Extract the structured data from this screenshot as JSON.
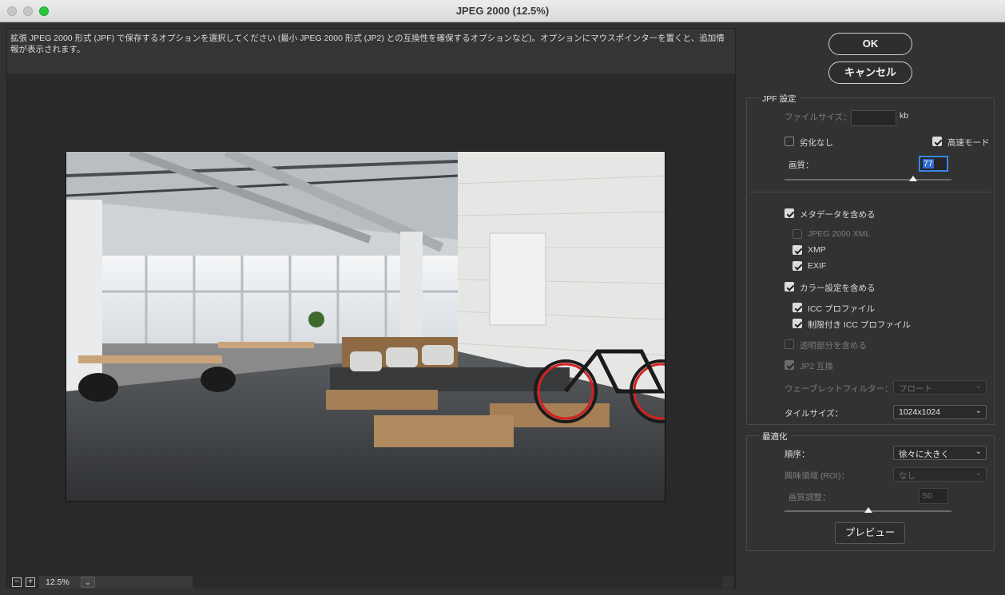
{
  "window": {
    "title": "JPEG 2000 (12.5%)"
  },
  "description": "拡張 JPEG 2000 形式 (JPF) で保存するオプションを選択してください (最小 JPEG 2000 形式 (JP2) との互換性を確保するオプションなど)。オプションにマウスポインターを置くと、追加情報が表示されます。",
  "preview": {
    "image_description_icon": "office-interior-photo"
  },
  "zoom": {
    "minus": "−",
    "plus": "+",
    "value": "12.5%",
    "dropdown": "⌄"
  },
  "buttons": {
    "ok": "OK",
    "cancel": "キャンセル",
    "preview": "プレビュー"
  },
  "jpf_settings": {
    "title": "JPF 設定",
    "file_size_label": "ファイルサイズ：",
    "file_size_value": "",
    "file_size_unit": "kb",
    "lossless_label": "劣化なし",
    "lossless_checked": false,
    "fast_mode_label": "高速モード",
    "fast_mode_checked": true,
    "quality_label": "画質：",
    "quality_value": "77",
    "quality_fraction": 0.77,
    "include_metadata_label": "メタデータを含める",
    "include_metadata_checked": true,
    "jpeg2000_xml_label": "JPEG 2000 XML",
    "jpeg2000_xml_checked": false,
    "xmp_label": "XMP",
    "xmp_checked": true,
    "exif_label": "EXIF",
    "exif_checked": true,
    "include_color_label": "カラー設定を含める",
    "include_color_checked": true,
    "icc_profile_label": "ICC プロファイル",
    "icc_profile_checked": true,
    "restricted_icc_label": "制限付き ICC プロファイル",
    "restricted_icc_checked": true,
    "include_transparency_label": "透明部分を含める",
    "include_transparency_checked": false,
    "jp2_compat_label": "JP2 互換",
    "jp2_compat_checked": true,
    "wavelet_filter_label": "ウェーブレットフィルター：",
    "wavelet_filter_value": "フロート",
    "tile_size_label": "タイルサイズ：",
    "tile_size_value": "1024x1024"
  },
  "optimization": {
    "title": "最適化",
    "order_label": "順序：",
    "order_value": "徐々に大きく",
    "roi_label": "興味領域 (ROI)：",
    "roi_value": "なし",
    "quality_adjust_label": "画質調整：",
    "quality_adjust_value": "50",
    "quality_adjust_fraction": 0.5
  },
  "colors": {
    "accent_focus": "#3b86e8",
    "bike_rim": "#d42020"
  }
}
